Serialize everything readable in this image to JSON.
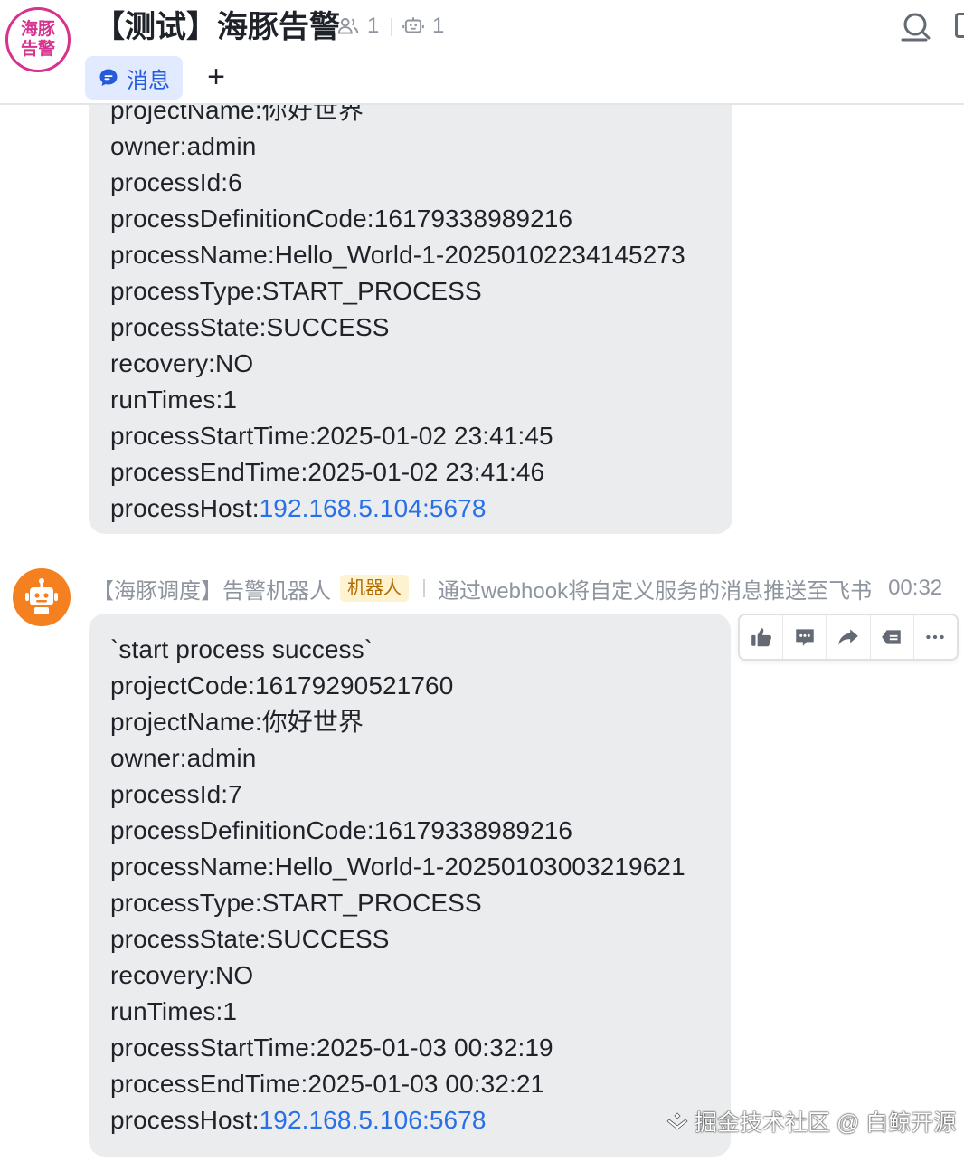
{
  "header": {
    "group_avatar_line1": "海豚",
    "group_avatar_line2": "告警",
    "title": "【测试】海豚告警",
    "member_count": "1",
    "bot_count": "1",
    "tab_message_label": "消息",
    "tab_add_label": "+",
    "icons": {
      "members": "members-icon",
      "bots": "robot-icon",
      "search": "search-icon",
      "tab": "chat-bubble-icon"
    }
  },
  "message_1": {
    "partial_first_line": "projectName:你好世界",
    "lines": [
      "owner:admin",
      "processId:6",
      "processDefinitionCode:16179338989216",
      "processName:Hello_World-1-20250102234145273",
      "processType:START_PROCESS",
      "processState:SUCCESS",
      "recovery:NO",
      "runTimes:1",
      "processStartTime:2025-01-02 23:41:45",
      "processEndTime:2025-01-02 23:41:46"
    ],
    "host_label": "processHost:",
    "host_link": "192.168.5.104:5678"
  },
  "message_2": {
    "sender": "【海豚调度】告警机器人",
    "badge": "机器人",
    "description": "通过webhook将自定义服务的消息推送至飞书",
    "time": "00:32",
    "lines": [
      "`start process success`",
      "projectCode:16179290521760",
      "projectName:你好世界",
      "owner:admin",
      "processId:7",
      "processDefinitionCode:16179338989216",
      "processName:Hello_World-1-20250103003219621",
      "processType:START_PROCESS",
      "processState:SUCCESS",
      "recovery:NO",
      "runTimes:1",
      "processStartTime:2025-01-03 00:32:19",
      "processEndTime:2025-01-03 00:32:21"
    ],
    "host_label": "processHost:",
    "host_link": "192.168.5.106:5678"
  },
  "toolbar": {
    "icons": [
      "thumbs-up-icon",
      "comment-icon",
      "forward-icon",
      "quote-reply-icon",
      "more-icon"
    ]
  },
  "watermark": {
    "text": "掘金技术社区 @ 白鲸开源"
  },
  "colors": {
    "accent": "#245bdb",
    "link": "#2970e8",
    "bubble": "#ebeced",
    "avatar_pink": "#d6338f",
    "bot_orange": "#f5801f",
    "badge_bg": "#fdf3d1",
    "badge_text": "#b26b00"
  }
}
